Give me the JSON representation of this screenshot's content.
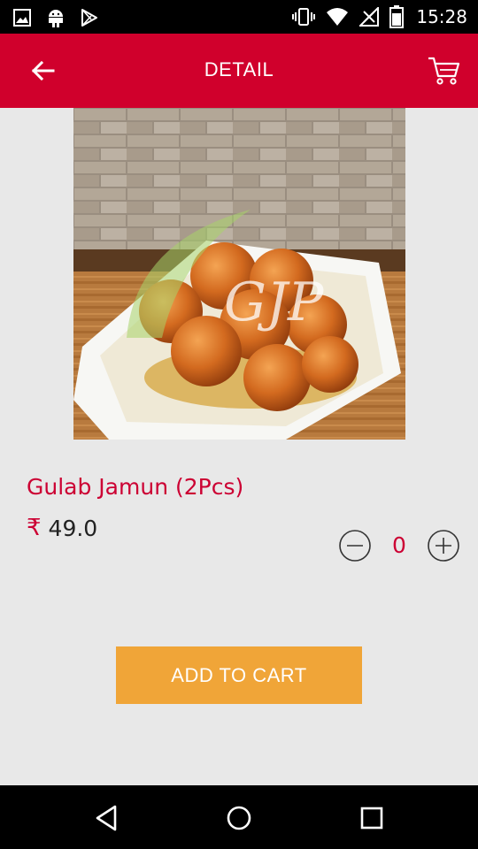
{
  "status_bar": {
    "time": "15:28",
    "icons": [
      "image-icon",
      "android-icon",
      "play-store-icon",
      "vibrate-icon",
      "wifi-icon",
      "signal-icon",
      "battery-icon"
    ]
  },
  "app_bar": {
    "title": "DETAIL",
    "background": "#d0002c",
    "icons": [
      "back-arrow-icon",
      "cart-icon"
    ]
  },
  "product": {
    "name": "Gulab Jamun (2Pcs)",
    "currency_symbol": "₹",
    "price": "49.0",
    "quantity": "0",
    "watermark": "GJP",
    "name_color": "#cc0033"
  },
  "actions": {
    "add_to_cart_label": "ADD TO CART",
    "button_color": "#f0a538"
  },
  "nav_bar": {
    "icons": [
      "back-triangle-icon",
      "home-circle-icon",
      "recents-square-icon"
    ]
  }
}
